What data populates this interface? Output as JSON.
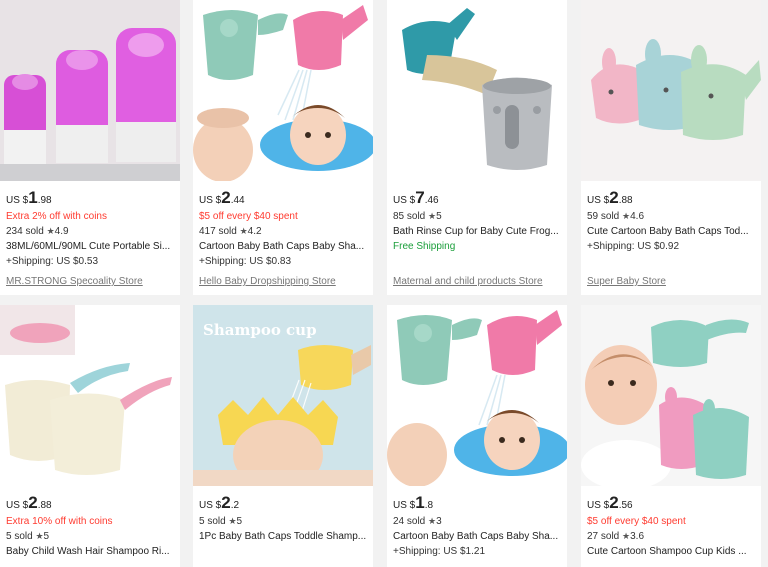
{
  "products": [
    {
      "price_currency": "US $",
      "price_int": "1",
      "price_dec": ".98",
      "promo": "Extra 2% off with coins",
      "sold": "234 sold",
      "rating": "4.9",
      "title": "38ML/60ML/90ML Cute Portable Si...",
      "shipping": "+Shipping: US $0.53",
      "store": "MR.STRONG Specoality Store"
    },
    {
      "price_currency": "US $",
      "price_int": "2",
      "price_dec": ".44",
      "promo": "$5 off every $40 spent",
      "sold": "417 sold",
      "rating": "4.2",
      "title": "Cartoon Baby Bath Caps Baby Sha...",
      "shipping": "+Shipping: US $0.83",
      "store": "Hello Baby Dropshipping Store"
    },
    {
      "price_currency": "US $",
      "price_int": "7",
      "price_dec": ".46",
      "promo": "",
      "sold": "85 sold",
      "rating": "5",
      "title": "Bath Rinse Cup for Baby Cute Frog...",
      "shipping": "Free Shipping",
      "store": "Maternal and child products Store"
    },
    {
      "price_currency": "US $",
      "price_int": "2",
      "price_dec": ".88",
      "promo": "",
      "sold": "59 sold",
      "rating": "4.6",
      "title": "Cute Cartoon Baby Bath Caps Tod...",
      "shipping": "+Shipping: US $0.92",
      "store": "Super Baby Store"
    },
    {
      "price_currency": "US $",
      "price_int": "2",
      "price_dec": ".88",
      "promo": "Extra 10% off with coins",
      "sold": "5 sold",
      "rating": "5",
      "title": "Baby Child Wash Hair Shampoo Ri...",
      "shipping": "",
      "store": ""
    },
    {
      "price_currency": "US $",
      "price_int": "2",
      "price_dec": ".2",
      "promo": "",
      "sold": "5 sold",
      "rating": "5",
      "title": "1Pc Baby Bath Caps Toddle Shamp...",
      "shipping": "",
      "store": "",
      "image_caption": "Shampoo cup"
    },
    {
      "price_currency": "US $",
      "price_int": "1",
      "price_dec": ".8",
      "promo": "",
      "sold": "24 sold",
      "rating": "3",
      "title": "Cartoon Baby Bath Caps Baby Sha...",
      "shipping": "+Shipping: US $1.21",
      "store": ""
    },
    {
      "price_currency": "US $",
      "price_int": "2",
      "price_dec": ".56",
      "promo": "$5 off every $40 spent",
      "sold": "27 sold",
      "rating": "3.6",
      "title": "Cute Cartoon Shampoo Cup Kids ...",
      "shipping": "",
      "store": ""
    }
  ],
  "icons": {
    "rating": "star-icon"
  },
  "colors": {
    "promo": "#ff3b30",
    "free_shipping": "#1a9e3a",
    "store_link": "#777777"
  }
}
